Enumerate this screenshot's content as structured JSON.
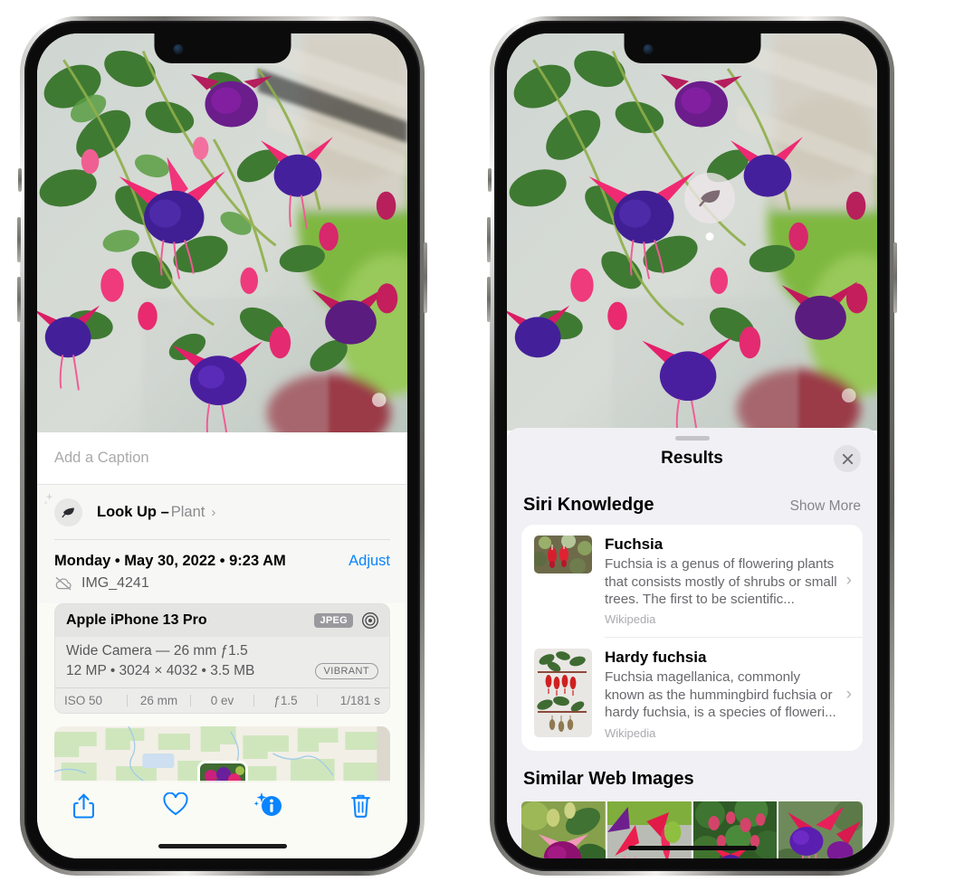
{
  "left_phone": {
    "caption": {
      "placeholder": "Add a Caption",
      "value": ""
    },
    "lookup": {
      "icon": "leaf-icon",
      "sparkle_icon": "sparkles-icon",
      "label": "Look Up –",
      "subject": "Plant",
      "chevron": "›"
    },
    "meta": {
      "date": "Monday • May 30, 2022 • 9:23 AM",
      "adjust_label": "Adjust",
      "cloud_icon": "icloud-slash-icon",
      "filename": "IMG_4241"
    },
    "exif": {
      "device": "Apple iPhone 13 Pro",
      "format_badge": "JPEG",
      "aperture_icon": "aperture-icon",
      "lens_line": "Wide Camera — 26 mm ƒ1.5",
      "size_line": "12 MP • 3024 × 4032 • 3.5 MB",
      "style_badge": "VIBRANT",
      "stats": [
        "ISO 50",
        "26 mm",
        "0 ev",
        "ƒ1.5",
        "1/181 s"
      ]
    },
    "toolbar": [
      {
        "name": "share-icon",
        "label": "Share"
      },
      {
        "name": "heart-icon",
        "label": "Favorite"
      },
      {
        "name": "info-sparkle-icon",
        "label": "Info"
      },
      {
        "name": "trash-icon",
        "label": "Delete"
      }
    ],
    "accent_color": "#0a84ff"
  },
  "right_phone": {
    "visual_lookup_badge": {
      "icon": "leaf-icon"
    },
    "sheet": {
      "title": "Results",
      "close_icon": "close-icon",
      "grabber": "drag-handle"
    },
    "siri_knowledge": {
      "section_title": "Siri Knowledge",
      "show_more": "Show More",
      "items": [
        {
          "title": "Fuchsia",
          "description": "Fuchsia is a genus of flowering plants that consists mostly of shrubs or small trees. The first to be scientific...",
          "source": "Wikipedia",
          "chevron": "›"
        },
        {
          "title": "Hardy fuchsia",
          "description": "Fuchsia magellanica, commonly known as the hummingbird fuchsia or hardy fuchsia, is a species of floweri...",
          "source": "Wikipedia",
          "chevron": "›"
        }
      ]
    },
    "similar_web_images": {
      "section_title": "Similar Web Images",
      "count": 4
    }
  }
}
